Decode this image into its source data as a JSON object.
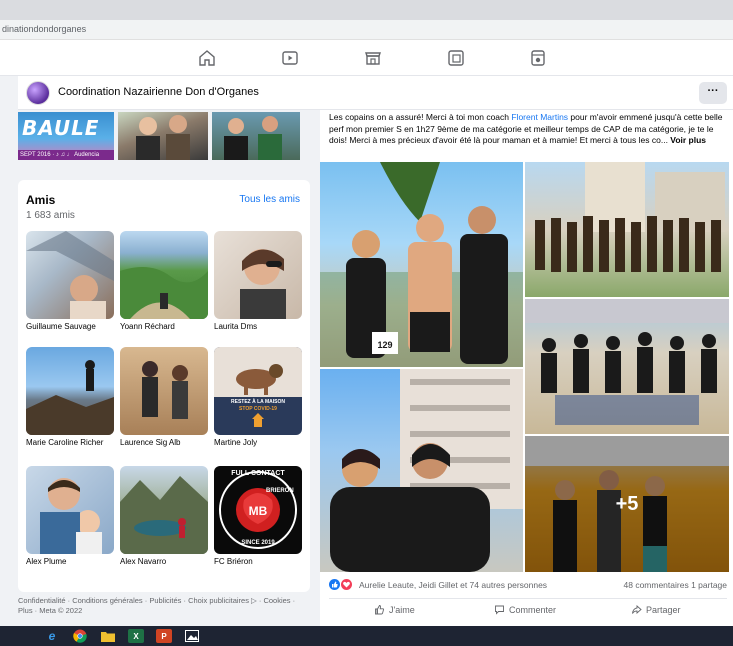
{
  "browser": {
    "address": "dinationdondorganes"
  },
  "nav": {
    "icons": [
      "home-icon",
      "watch-icon",
      "marketplace-icon",
      "groups-icon",
      "gaming-icon"
    ]
  },
  "page": {
    "name": "Coordination Nazairienne Don d'Organes",
    "more_label": "···"
  },
  "top_photos": {
    "baule_title": "BAULE",
    "baule_strip": "SEPT 2016 · ♪ ♫ ♩ Audencia"
  },
  "friends": {
    "title": "Amis",
    "count": "1 683 amis",
    "see_all": "Tous les amis",
    "items": [
      {
        "name": "Guillaume Sauvage"
      },
      {
        "name": "Yoann Réchard"
      },
      {
        "name": "Laurita Dms"
      },
      {
        "name": "Marie Caroline Richer"
      },
      {
        "name": "Laurence Sig Alb"
      },
      {
        "name": "Martine Joly"
      },
      {
        "name": "Alex Plume"
      },
      {
        "name": "Alex Navarro"
      },
      {
        "name": "FC Briéron"
      }
    ],
    "poster_text": {
      "line1": "RESTEZ À LA MAISON",
      "line2": "STOP COVID-19"
    },
    "logo_text": {
      "top": "FULL CONTACT",
      "side": "BRIERON",
      "center": "MB",
      "bottom": "SINCE 2019"
    }
  },
  "footer": {
    "line1": "Confidentialité · Conditions générales · Publicités · Choix publicitaires ▷ · Cookies ·",
    "line2": "Plus · Meta © 2022"
  },
  "post": {
    "text_before_link": "Les copains on a assuré! Merci à toi mon coach ",
    "link": "Florent Martins",
    "text_after_link": " pour m'avoir emmené jusqu'à cette belle perf mon premier S en 1h27 9ème de ma catégorie et meilleur temps de CAP de ma catégorie, je te le dois! Merci à mes précieux d'avoir été là pour maman et à mamie! Et merci à tous les co... ",
    "see_more": "Voir plus",
    "photo_more": "+5",
    "bib_number": "129",
    "reactions_text": "Aurelie Leaute, Jeidi Gillet et 74 autres personnes",
    "comments_count": "48 commentaires",
    "shares_count": "1 partage",
    "like_label": "J'aime",
    "comment_label": "Commenter",
    "share_label": "Partager"
  },
  "colors": {
    "link": "#1877f2",
    "like": "#1877f2",
    "love": "#f33e58",
    "page_bg": "#f0f2f5"
  },
  "taskbar": {
    "icons": [
      "edge-icon",
      "chrome-icon",
      "folder-icon",
      "excel-icon",
      "powerpoint-icon",
      "photos-icon"
    ],
    "excel_label": "X",
    "ppt_label": "P"
  }
}
